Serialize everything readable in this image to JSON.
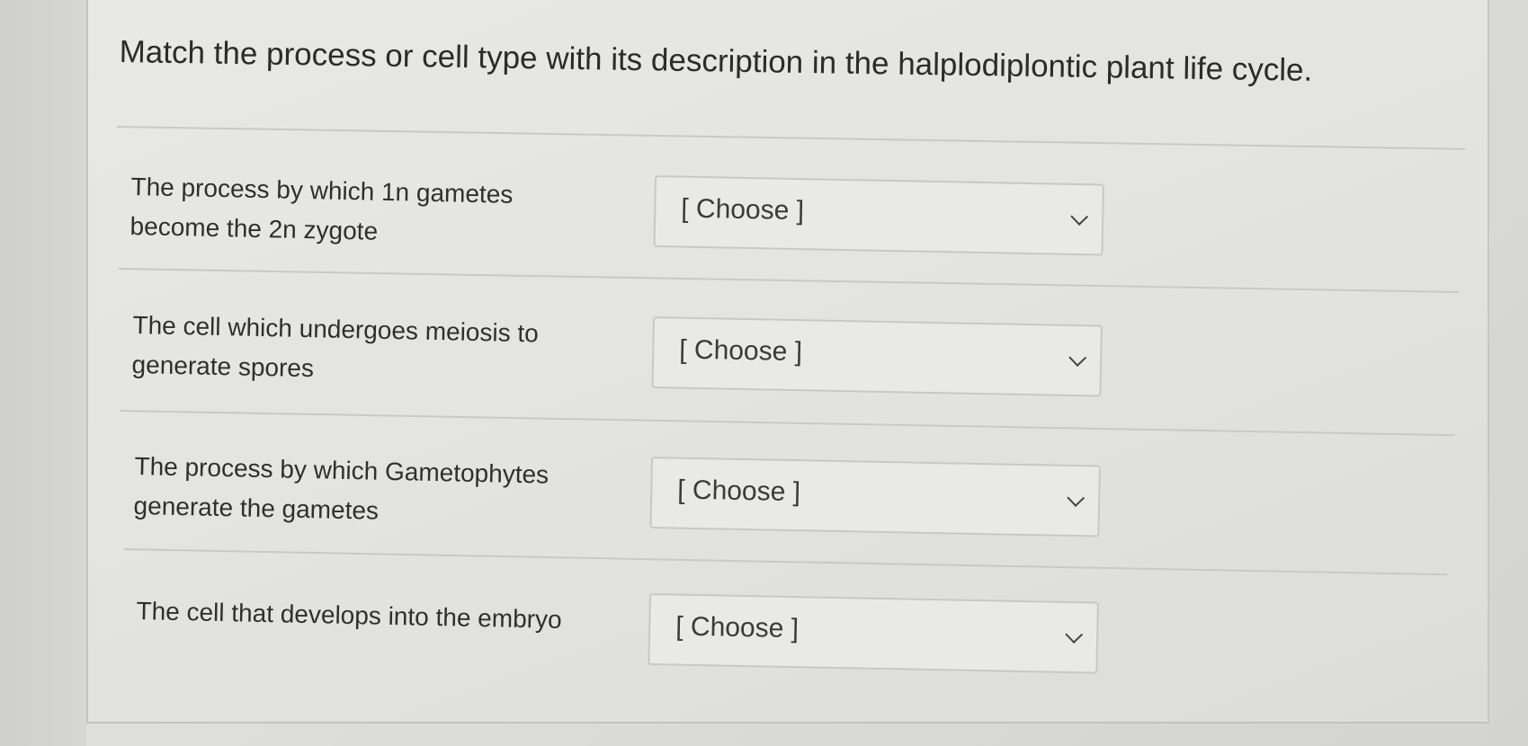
{
  "question": "Match the process or cell type with its description in the halplodiplontic plant life cycle.",
  "rows": [
    {
      "label_line1": "The process by which 1n gametes",
      "label_line2": "become the 2n zygote",
      "select": "[ Choose ]"
    },
    {
      "label_line1": "The cell which undergoes meiosis to",
      "label_line2": "generate spores",
      "select": "[ Choose ]"
    },
    {
      "label_line1": "The process by which Gametophytes",
      "label_line2": "generate the gametes",
      "select": "[ Choose ]"
    },
    {
      "label_line1": "The cell that develops into the embryo",
      "label_line2": "",
      "select": "[ Choose ]"
    }
  ],
  "icons": {
    "dropdown": "chevron-down-icon"
  }
}
